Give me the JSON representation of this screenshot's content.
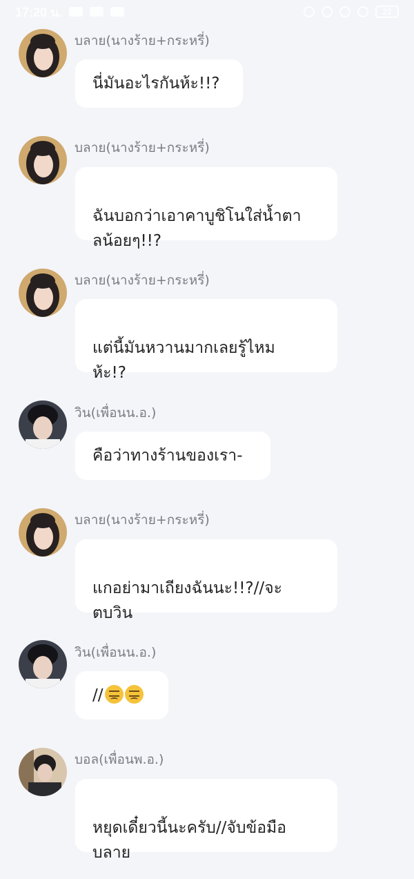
{
  "status_bar": {
    "time": "17:20 น.",
    "battery": "22"
  },
  "messages": [
    {
      "sender": "บลาย(นางร้าย+กระหรี่)",
      "avatar": "avatar-blay",
      "text": "นี่มันอะไรกันห้ะ!!?"
    },
    {
      "sender": "บลาย(นางร้าย+กระหรี่)",
      "avatar": "avatar-blay",
      "text": "ฉันบอกว่าเอาคาบูชิโนใส่น้ำตา\nลน้อยๆ!!?"
    },
    {
      "sender": "บลาย(นางร้าย+กระหรี่)",
      "avatar": "avatar-blay",
      "text": "แต่นี้มันหวานมากเลยรู้ไหม\nห้ะ!?"
    },
    {
      "sender": "วิน(เพื่อนน.อ.)",
      "avatar": "avatar-win",
      "text": "คือว่าทางร้านของเรา-"
    },
    {
      "sender": "บลาย(นางร้าย+กระหรี่)",
      "avatar": "avatar-blay",
      "text": "แกอย่ามาเถียงฉันนะ!!?//จะ\nตบวิน"
    },
    {
      "sender": "วิน(เพื่อนน.อ.)",
      "avatar": "avatar-win",
      "text": "//",
      "emoji": [
        "confounded-face-emoji",
        "persevering-face-emoji"
      ]
    },
    {
      "sender": "บอล(เพื่อนพ.อ.)",
      "avatar": "avatar-ball",
      "text": "หยุดเดี๋ยวนี้นะครับ//จับข้อมือ\nบลาย"
    }
  ]
}
